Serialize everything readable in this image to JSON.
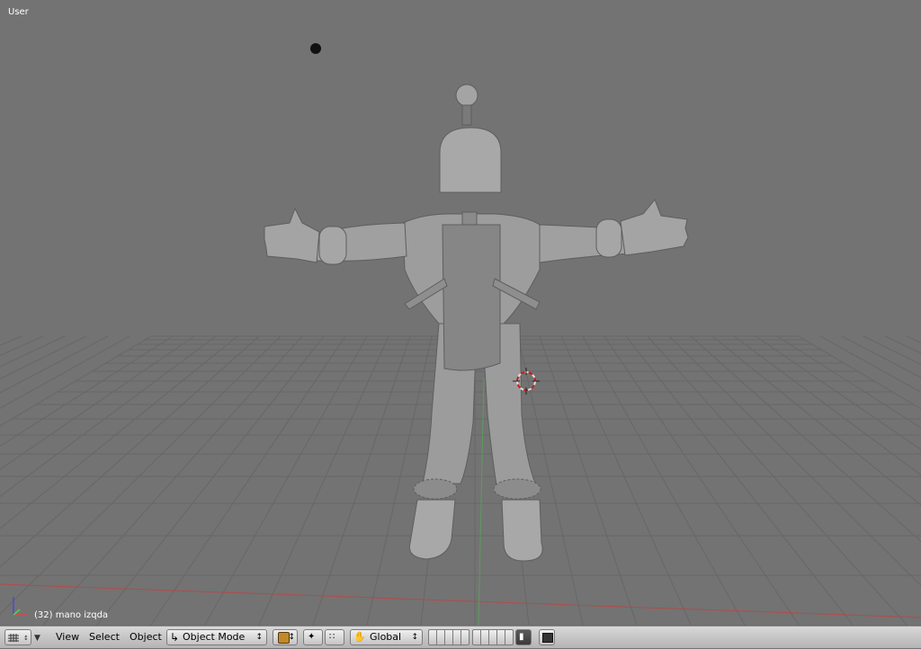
{
  "viewport": {
    "view_name": "User",
    "object_info": "(32) mano izqda",
    "background_color": "#737373",
    "grid_color": "#676767",
    "x_axis_color": "#b44a4a",
    "y_axis_color": "#5c9c5c"
  },
  "header": {
    "editor_type_icon": "grid-editor-icon",
    "menus": {
      "view": "View",
      "select": "Select",
      "object": "Object"
    },
    "mode": {
      "label": "Object Mode",
      "icon": "object-mode-icon"
    },
    "shading_icon": "solid-shading-icon",
    "pivot_icon": "pivot-point-icon",
    "manipulator_icon": "manipulator-icon",
    "orientation": {
      "label": "Global",
      "icon": "hand-icon"
    },
    "lock_icon": "lock-icon",
    "render_icon": "render-preview-icon"
  }
}
